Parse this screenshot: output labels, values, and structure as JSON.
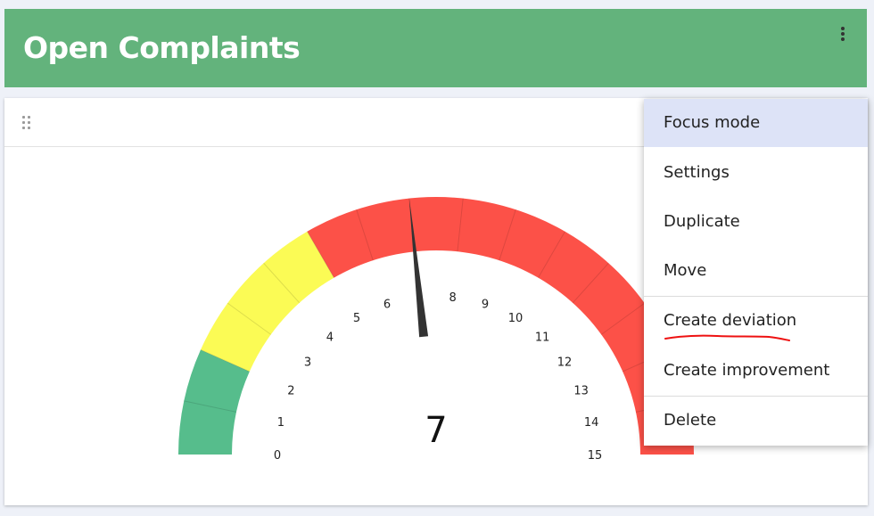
{
  "header": {
    "title": "Open Complaints",
    "menu_icon": "more-vert-icon",
    "background_color": "#63b37c"
  },
  "card": {
    "drag_icon": "drag-handle-icon"
  },
  "gauge": {
    "value": 7,
    "value_text": "7",
    "min": 0,
    "max": 15,
    "tick_labels": [
      "0",
      "1",
      "2",
      "3",
      "4",
      "5",
      "6",
      "7",
      "8",
      "9",
      "10",
      "11",
      "12",
      "13",
      "14",
      "15"
    ],
    "bands": [
      {
        "from": 0,
        "to": 2,
        "color": "#56bd8c"
      },
      {
        "from": 2,
        "to": 5,
        "color": "#fbfb55"
      },
      {
        "from": 5,
        "to": 15,
        "color": "#fc5148"
      }
    ]
  },
  "context_menu": {
    "items": [
      {
        "label": "Focus mode",
        "active": true
      },
      {
        "label": "Settings"
      },
      {
        "label": "Duplicate"
      },
      {
        "label": "Move"
      },
      {
        "label": "Create deviation",
        "annotated": true
      },
      {
        "label": "Create improvement"
      },
      {
        "label": "Delete"
      }
    ],
    "annotation_color": "#ee1111"
  }
}
